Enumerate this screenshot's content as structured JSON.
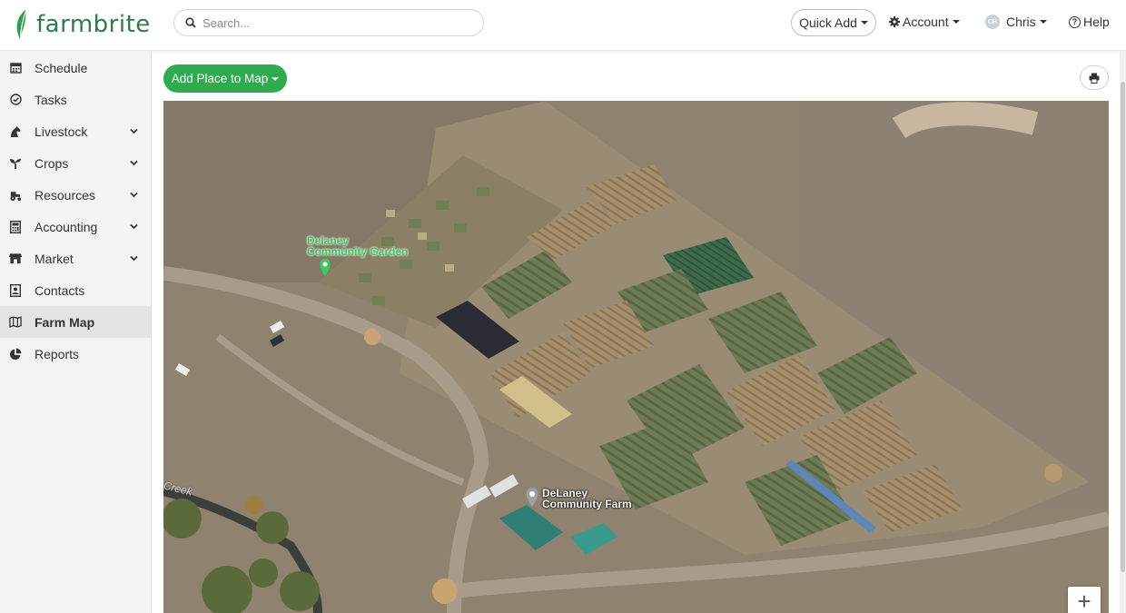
{
  "brand": {
    "name": "farmbrite"
  },
  "header": {
    "search_placeholder": "Search...",
    "quick_add_label": "Quick Add",
    "account_label": "Account",
    "user_initials": "CH",
    "user_name": "Chris",
    "help_label": "Help"
  },
  "sidebar": {
    "items": [
      {
        "label": "Schedule",
        "icon": "calendar-icon",
        "expandable": false
      },
      {
        "label": "Tasks",
        "icon": "check-circle-icon",
        "expandable": false
      },
      {
        "label": "Livestock",
        "icon": "horse-icon",
        "expandable": true
      },
      {
        "label": "Crops",
        "icon": "seedling-icon",
        "expandable": true
      },
      {
        "label": "Resources",
        "icon": "tractor-icon",
        "expandable": true
      },
      {
        "label": "Accounting",
        "icon": "calculator-icon",
        "expandable": true
      },
      {
        "label": "Market",
        "icon": "store-icon",
        "expandable": true
      },
      {
        "label": "Contacts",
        "icon": "contact-card-icon",
        "expandable": false
      },
      {
        "label": "Farm Map",
        "icon": "map-icon",
        "expandable": false,
        "active": true
      },
      {
        "label": "Reports",
        "icon": "pie-chart-icon",
        "expandable": false
      }
    ]
  },
  "toolbar": {
    "add_place_label": "Add Place to Map",
    "print_icon": "print-icon"
  },
  "map": {
    "markers": [
      {
        "line1": "Delaney",
        "line2": "Community Garden",
        "color": "#3acb5c"
      },
      {
        "line1": "DeLaney",
        "line2": "Community Farm",
        "color": "#ffffff"
      }
    ],
    "creek_label": "Creek",
    "zoom_in_label": "+"
  },
  "colors": {
    "accent_green": "#2eaa4f",
    "brand_green": "#2e7d46"
  }
}
